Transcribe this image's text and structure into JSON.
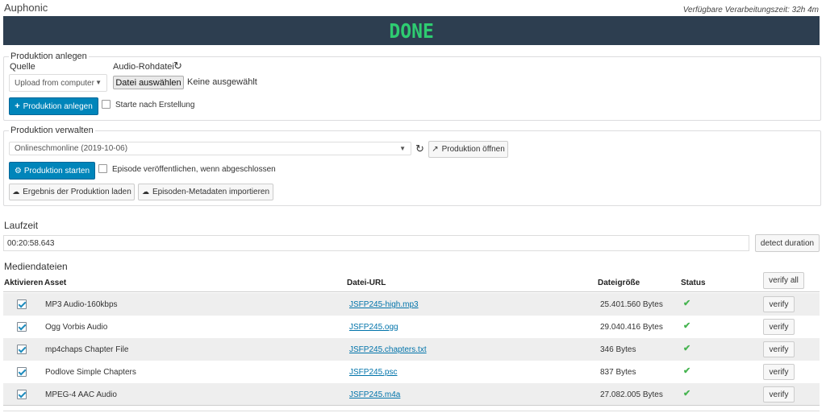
{
  "app": {
    "title": "Auphonic",
    "processing_time": "Verfügbare Verarbeitungszeit: 32h 4m",
    "status_banner": "DONE",
    "colors": {
      "banner_bg": "#2d3e50",
      "banner_text": "#2ecc71",
      "primary": "#0085ba",
      "link": "#0073aa",
      "ok": "#46b450"
    }
  },
  "create_production": {
    "legend": "Produktion anlegen",
    "source_label": "Quelle",
    "source_value": "Upload from computer",
    "raw_audio_label": "Audio-Rohdatei",
    "choose_file_label": "Datei auswählen",
    "no_file_label": "Keine ausgewählt",
    "create_button_label": "Produktion anlegen",
    "start_after_label": "Starte nach Erstellung",
    "start_after_checked": false,
    "icons": {
      "refresh": "refresh-icon",
      "create": "plus-icon"
    }
  },
  "manage_production": {
    "legend": "Produktion verwalten",
    "selected_production": "Onlineschmonline (2019-10-06)",
    "open_button_label": "Produktion öffnen",
    "start_button_label": "Produktion starten",
    "publish_label": "Episode veröffentlichen, wenn abgeschlossen",
    "publish_checked": false,
    "load_result_label": "Ergebnis der Produktion laden",
    "import_metadata_label": "Episoden-Metadaten importieren",
    "icons": {
      "refresh": "refresh-icon",
      "open": "external-link-icon",
      "start": "gears-icon",
      "load": "cloud-download-icon",
      "import": "cloud-download-icon"
    }
  },
  "duration": {
    "title": "Laufzeit",
    "value": "00:20:58.643",
    "detect_button_label": "detect duration"
  },
  "media": {
    "title": "Mediendateien",
    "headers": {
      "activate": "Aktivieren",
      "asset": "Asset",
      "url": "Datei-URL",
      "size": "Dateigröße",
      "status": "Status"
    },
    "verify_all_label": "verify all",
    "verify_label": "verify",
    "rows": [
      {
        "active": true,
        "asset": "MP3 Audio-160kbps",
        "url": "JSFP245-high.mp3",
        "size": "25.401.560 Bytes",
        "status": "ok"
      },
      {
        "active": true,
        "asset": "Ogg Vorbis Audio",
        "url": "JSFP245.ogg",
        "size": "29.040.416 Bytes",
        "status": "ok"
      },
      {
        "active": true,
        "asset": "mp4chaps Chapter File",
        "url": "JSFP245.chapters.txt",
        "size": "346 Bytes",
        "status": "ok"
      },
      {
        "active": true,
        "asset": "Podlove Simple Chapters",
        "url": "JSFP245.psc",
        "size": "837 Bytes",
        "status": "ok"
      },
      {
        "active": true,
        "asset": "MPEG-4 AAC Audio",
        "url": "JSFP245.m4a",
        "size": "27.082.005 Bytes",
        "status": "ok"
      }
    ]
  }
}
